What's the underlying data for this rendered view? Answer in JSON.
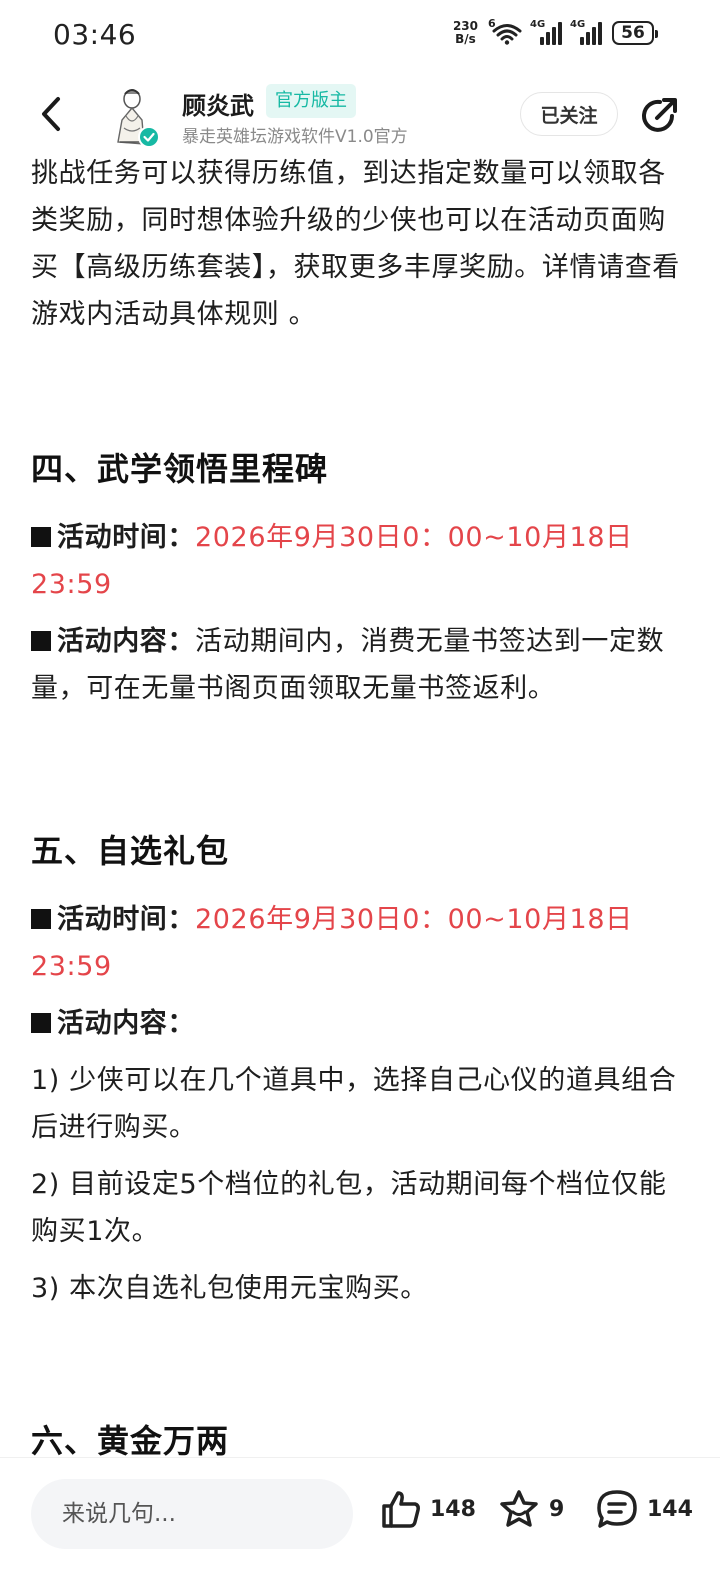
{
  "status": {
    "time": "03:46",
    "net_speed_value": "230",
    "net_speed_unit": "B/s",
    "wifi_label": "6",
    "signal1_label": "4G",
    "signal2_label": "4G",
    "battery": "56"
  },
  "header": {
    "author_name": "顾炎武",
    "official_badge": "官方版主",
    "author_subtitle": "暴走英雄坛游戏软件V1.0官方",
    "follow_label": "已关注"
  },
  "article": {
    "intro": "挑战任务可以获得历练值，到达指定数量可以领取各类奖励，同时想体验升级的少侠也可以在活动页面购买【高级历练套装】，获取更多丰厚奖励。详情请查看游戏内活动具体规则 。",
    "section4": {
      "title": "四、武学领悟里程碑",
      "time_label": "活动时间：",
      "time_value": "2026年9月30日0：00~10月18日23:59",
      "content_label": "活动内容：",
      "content_value": "活动期间内，消费无量书签达到一定数量，可在无量书阁页面领取无量书签返利。"
    },
    "section5": {
      "title": "五、自选礼包",
      "time_label": "活动时间：",
      "time_value": "2026年9月30日0：00~10月18日23:59",
      "content_label": "活动内容：",
      "items": [
        "1) 少侠可以在几个道具中，选择自己心仪的道具组合后进行购买。",
        "2) 目前设定5个档位的礼包，活动期间每个档位仅能购买1次。",
        "3) 本次自选礼包使用元宝购买。"
      ]
    },
    "section6": {
      "title": "六、黄金万两"
    }
  },
  "bottom": {
    "comment_placeholder": "来说几句...",
    "like_count": "148",
    "favorite_count": "9",
    "comment_count": "144"
  },
  "colors": {
    "accent_red": "#e4454a",
    "badge_teal": "#17b9a4"
  },
  "icons": [
    "back-icon",
    "verified-icon",
    "share-icon",
    "like-icon",
    "star-icon",
    "comment-icon",
    "wifi-icon",
    "signal-icon",
    "battery-icon"
  ]
}
